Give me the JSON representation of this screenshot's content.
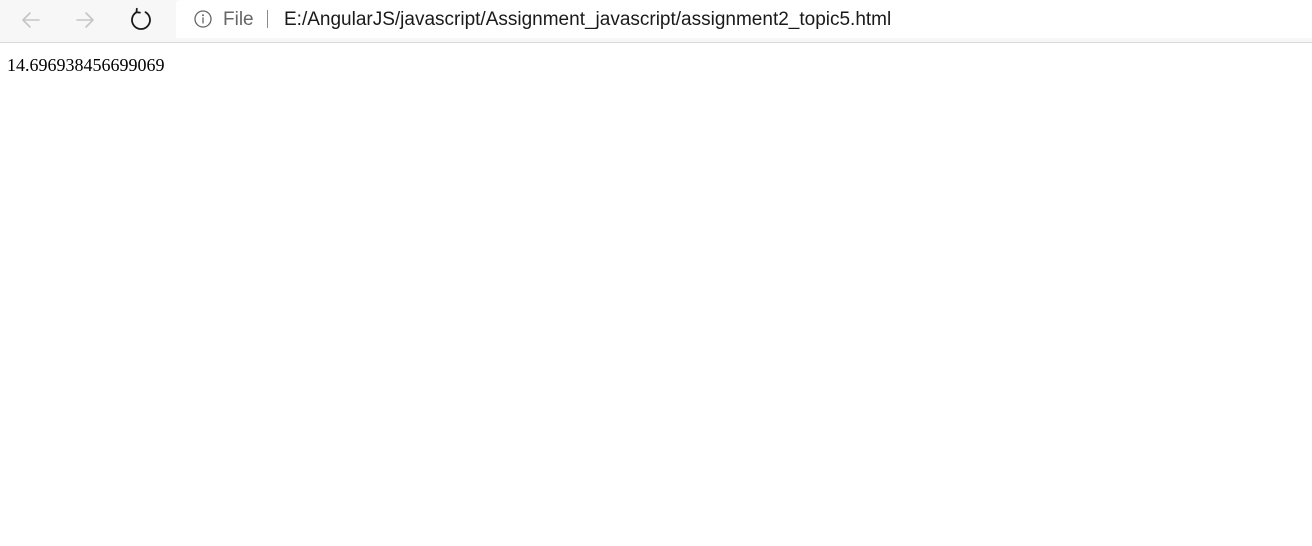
{
  "browser": {
    "nav": {
      "back_icon": "arrow-left-icon",
      "forward_icon": "arrow-right-icon",
      "reload_icon": "reload-icon"
    },
    "address_bar": {
      "info_icon": "info-icon",
      "scheme_label": "File",
      "url": "E:/AngularJS/javascript/Assignment_javascript/assignment2_topic5.html"
    },
    "colors": {
      "toolbar_bg": "#f7f7f7",
      "address_bg": "#ffffff",
      "disabled_icon": "#c6c6c6",
      "active_icon": "#1a1a1a"
    }
  },
  "page": {
    "output": "14.696938456699069"
  }
}
